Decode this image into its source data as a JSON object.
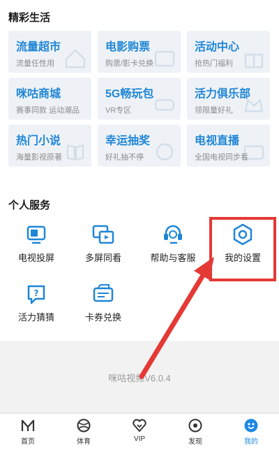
{
  "colors": {
    "accent": "#1f86d6",
    "highlight": "#e53935",
    "tile_bg": "#eef2f7"
  },
  "sections": {
    "featured_title": "精彩生活",
    "personal_title": "个人服务"
  },
  "tiles": [
    {
      "title": "流量超市",
      "subtitle": "流量任性用"
    },
    {
      "title": "电影购票",
      "subtitle": "购票/影卡兑换"
    },
    {
      "title": "活动中心",
      "subtitle": "抢热门福利"
    },
    {
      "title": "咪咕商城",
      "subtitle": "赛事同款 运动潮品"
    },
    {
      "title": "5G畅玩包",
      "subtitle": "VR专区"
    },
    {
      "title": "活力俱乐部",
      "subtitle": "领限量好礼"
    },
    {
      "title": "热门小说",
      "subtitle": "海量影视原著"
    },
    {
      "title": "幸运抽奖",
      "subtitle": "好礼抽不停"
    },
    {
      "title": "电视直播",
      "subtitle": "全国电视同步看"
    }
  ],
  "services": [
    {
      "label": "电视投屏",
      "icon": "tv-cast-icon"
    },
    {
      "label": "多屏同看",
      "icon": "multi-screen-icon"
    },
    {
      "label": "帮助与客服",
      "icon": "headset-icon"
    },
    {
      "label": "我的设置",
      "icon": "settings-hexagon-icon"
    },
    {
      "label": "活力猜猜",
      "icon": "guess-bubble-icon"
    },
    {
      "label": "卡券兑换",
      "icon": "coupon-icon"
    }
  ],
  "version": "咪咕视频V6.0.4",
  "tabs": [
    {
      "label": "首页",
      "icon": "home-logo-icon"
    },
    {
      "label": "体育",
      "icon": "basketball-icon"
    },
    {
      "label": "VIP",
      "icon": "vip-heart-icon"
    },
    {
      "label": "发现",
      "icon": "discover-icon"
    },
    {
      "label": "我的",
      "icon": "profile-icon",
      "active": true
    }
  ]
}
